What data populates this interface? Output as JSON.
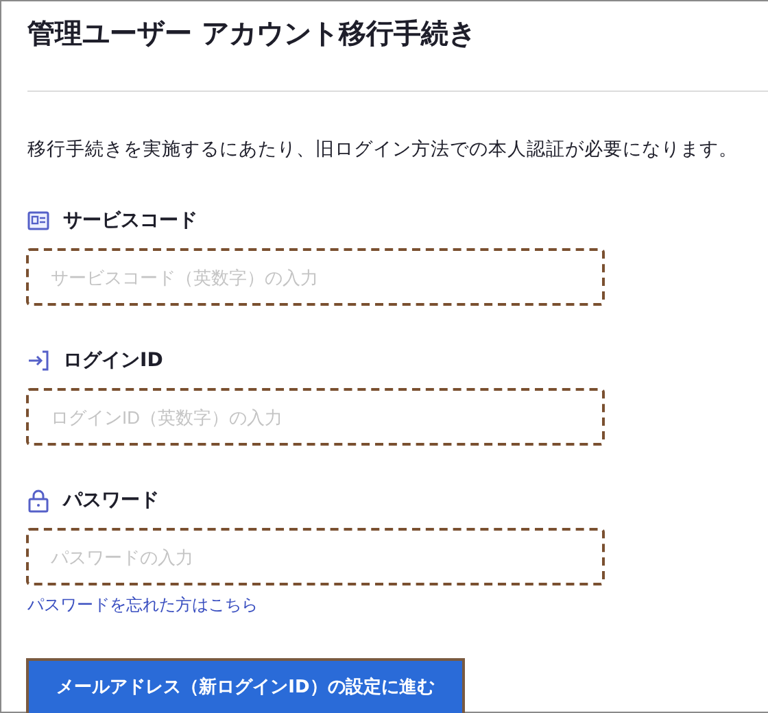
{
  "title": "管理ユーザー アカウント移行手続き",
  "description": "移行手続きを実施するにあたり、旧ログイン方法での本人認証が必要になります。",
  "fields": [
    {
      "kind": "service-code",
      "label": "サービスコード",
      "placeholder": "サービスコード（英数字）の入力"
    },
    {
      "kind": "login",
      "label": "ログインID",
      "placeholder": "ログインID（英数字）の入力"
    },
    {
      "kind": "password",
      "label": "パスワード",
      "placeholder": "パスワードの入力"
    }
  ],
  "forgot_link": "パスワードを忘れた方はこちら",
  "submit_button": "メールアドレス（新ログインID）の設定に進む"
}
